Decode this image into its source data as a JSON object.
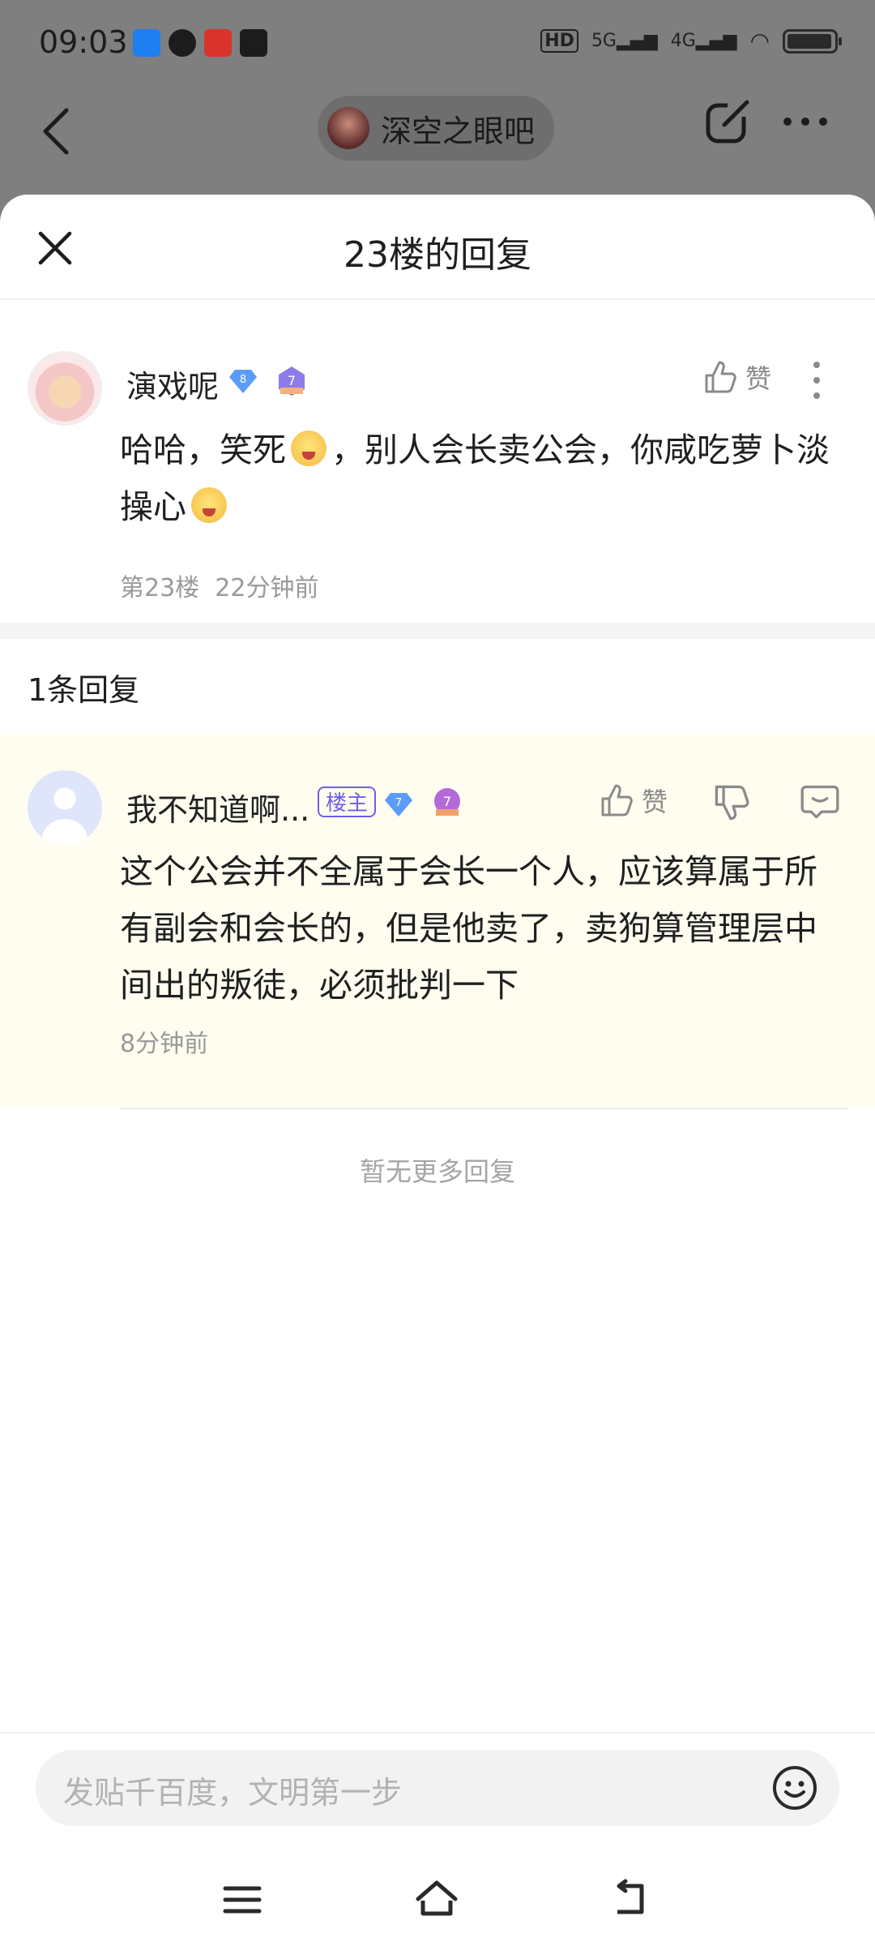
{
  "status_bar": {
    "time": "09:03",
    "signal_labels": [
      "HD",
      "5G",
      "4G"
    ]
  },
  "top_nav": {
    "forum_name": "深空之眼吧"
  },
  "sheet": {
    "title": "23楼的回复"
  },
  "post": {
    "username": "演戏呢",
    "user_level": "8",
    "forum_level": "7",
    "like_label": "赞",
    "text_part1": "哈哈，笑死",
    "text_part2": "，别人会长卖公会，你咸吃萝卜淡操心",
    "floor": "第23楼",
    "time": "22分钟前"
  },
  "reply_section": {
    "count_label": "1条回复"
  },
  "reply": {
    "username": "我不知道啊...",
    "owner_tag": "楼主",
    "user_level": "7",
    "forum_level": "7",
    "like_label": "赞",
    "text": "这个公会并不全属于会长一个人，应该算属于所有副会和会长的，但是他卖了，卖狗算管理层中间出的叛徒，必须批判一下",
    "time": "8分钟前"
  },
  "no_more_label": "暂无更多回复",
  "input": {
    "placeholder": "发贴千百度，文明第一步"
  },
  "colors": {
    "accent_purple": "#6f60e8",
    "reply_bg": "#fefdf0",
    "diamond_blue": "#5b9cf8"
  }
}
